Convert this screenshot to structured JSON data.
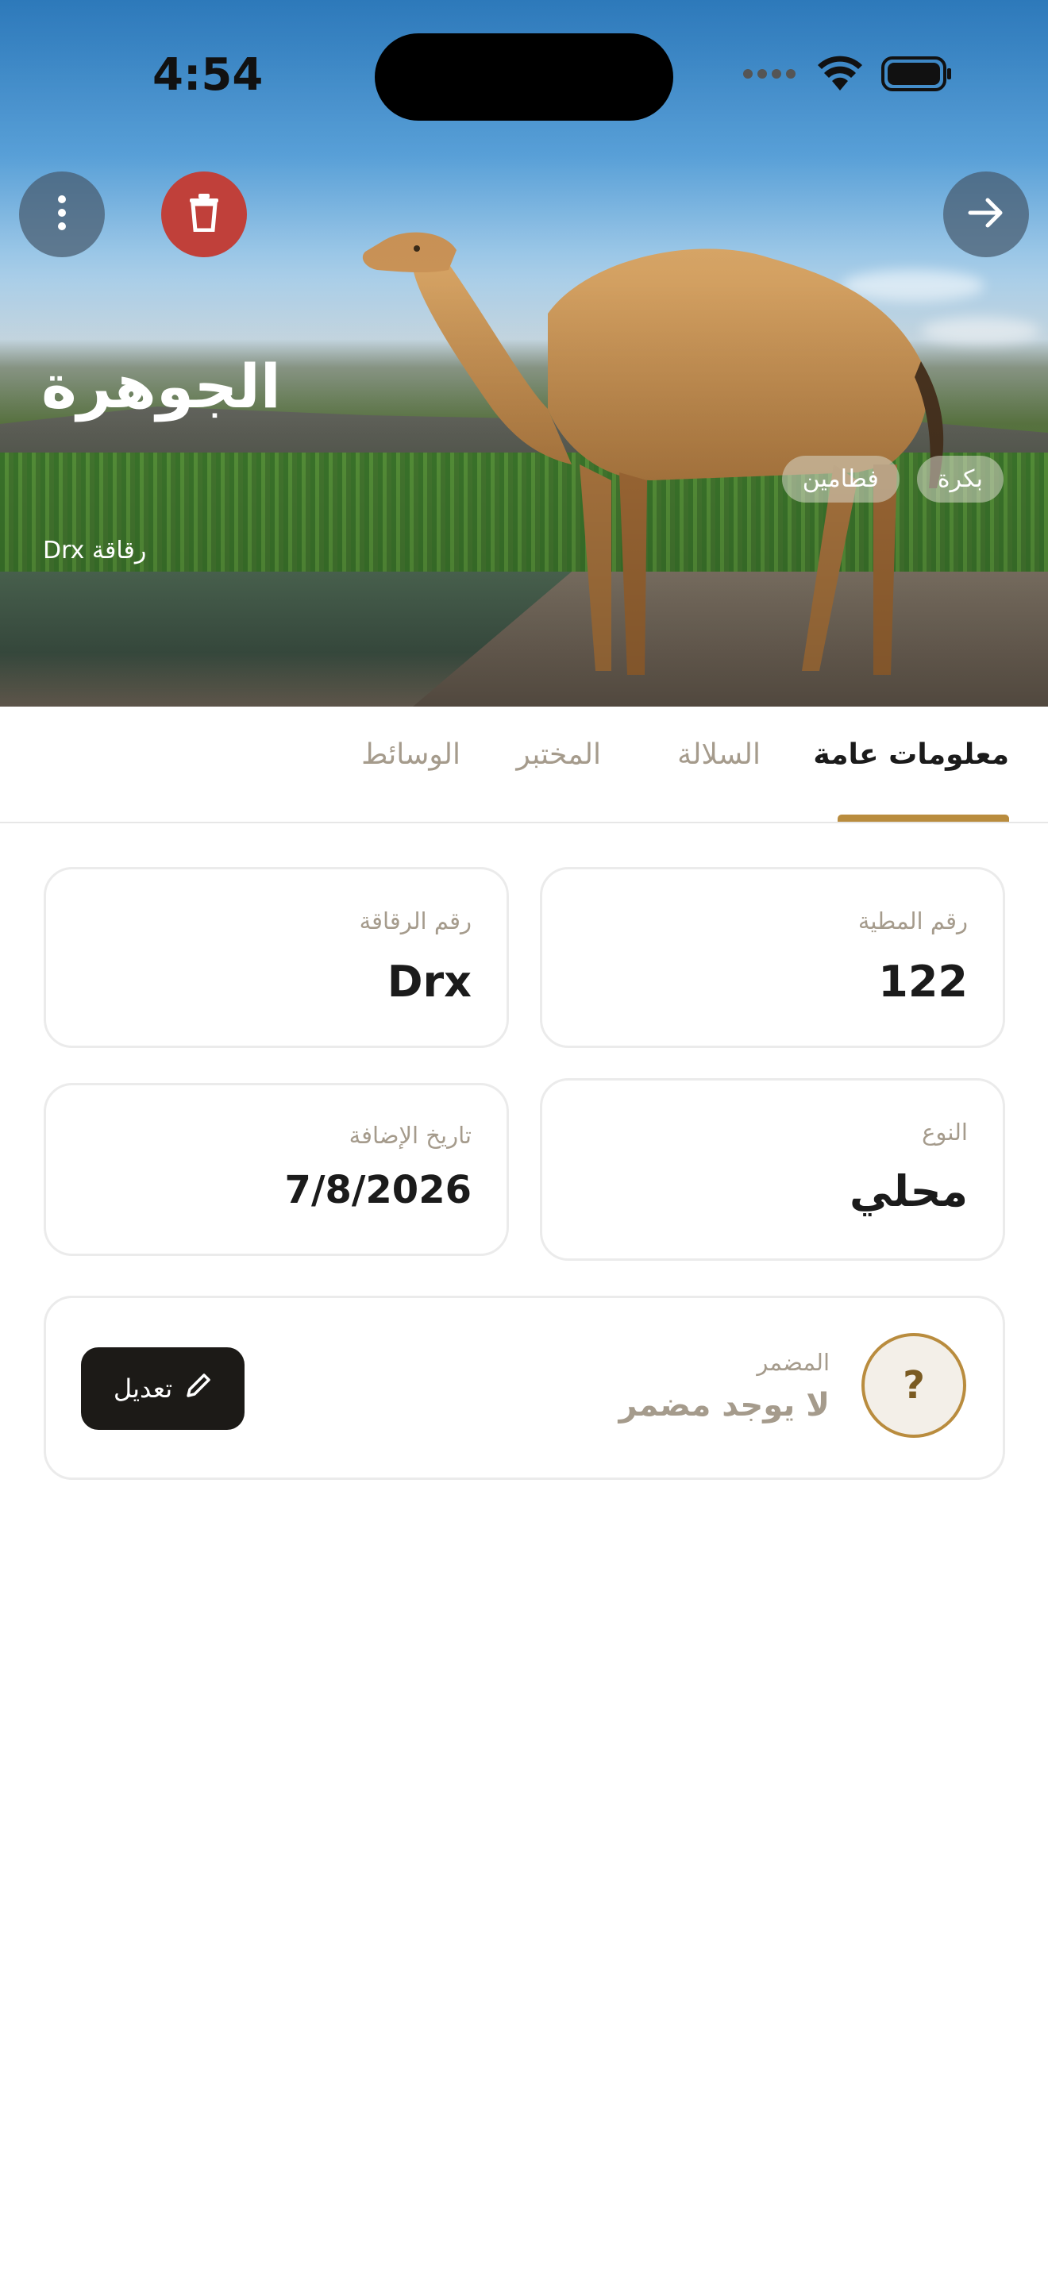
{
  "status_bar": {
    "time": "4:54"
  },
  "hero": {
    "name": "الجوهرة",
    "chip_label": "رقاقة Drx",
    "tags": [
      "بكرة",
      "فطامين"
    ]
  },
  "tabs": [
    {
      "label": "معلومات عامة",
      "active": true
    },
    {
      "label": "السلالة",
      "active": false
    },
    {
      "label": "المختبر",
      "active": false
    },
    {
      "label": "الوسائط",
      "active": false
    }
  ],
  "info": {
    "camel_number": {
      "label": "رقم المطية",
      "value": "122"
    },
    "chip_number": {
      "label": "رقم الرقاقة",
      "value": "Drx"
    },
    "type": {
      "label": "النوع",
      "value": "محلي"
    },
    "date_added": {
      "label": "تاريخ الإضافة",
      "value": "7/8/2026"
    }
  },
  "trainer": {
    "icon": "?",
    "label": "المضمر",
    "value": "لا يوجد مضمر",
    "edit_label": "تعديل"
  },
  "colors": {
    "accent": "#b98c3e",
    "delete": "#c0403a",
    "dark_button": "#1c1a17"
  }
}
